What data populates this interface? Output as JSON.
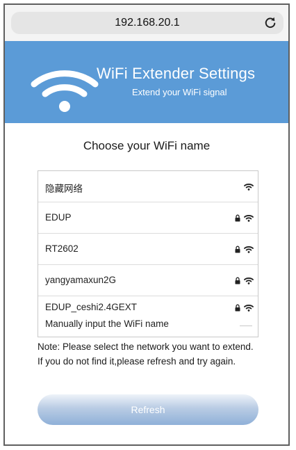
{
  "browser": {
    "url": "192.168.20.1",
    "reload_icon": "reload-icon"
  },
  "banner": {
    "logo_icon": "wifi-logo-icon",
    "title": "WiFi Extender Settings",
    "subtitle": "Extend your WiFi signal",
    "color": "#5b9bd7"
  },
  "main": {
    "choose_title": "Choose your WiFi name",
    "networks": [
      {
        "name": "隐藏网络",
        "secured": false
      },
      {
        "name": "EDUP",
        "secured": true
      },
      {
        "name": "RT2602",
        "secured": true
      },
      {
        "name": "yangyamaxun2G",
        "secured": true
      },
      {
        "name": "EDUP_ceshi2.4GEXT",
        "secured": true
      }
    ],
    "manual_label": "Manually input the WiFi name",
    "note": "Note: Please select the network you want to extend. If you do not find it,please refresh and try again.",
    "refresh_label": "Refresh"
  }
}
